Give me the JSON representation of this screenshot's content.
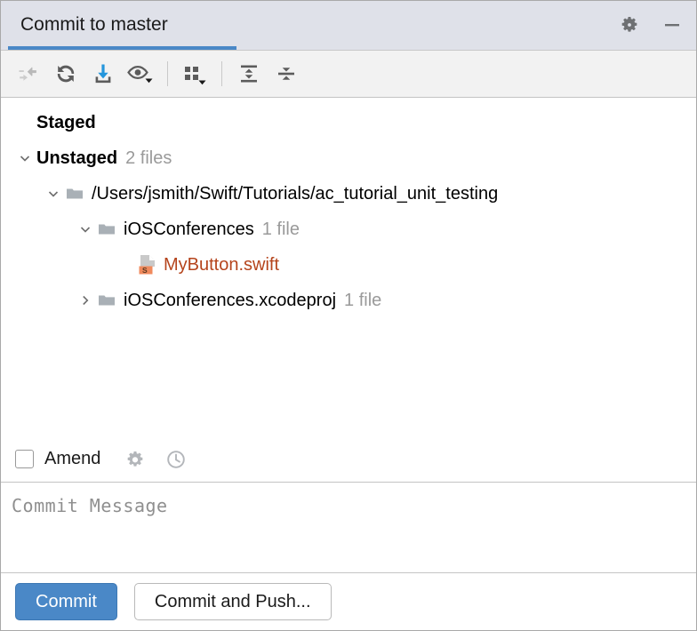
{
  "window": {
    "tab_title": "Commit to master",
    "accent_color": "#4a88c7",
    "header_bg": "#dfe1e9",
    "settings_icon": "gear-icon",
    "minimize_icon": "minimize-icon"
  },
  "toolbar": {
    "items": [
      {
        "name": "collapse-changes-icon",
        "tooltip": "Collapse",
        "enabled": false
      },
      {
        "name": "refresh-icon",
        "tooltip": "Refresh",
        "enabled": true
      },
      {
        "name": "revert-download-icon",
        "tooltip": "Revert",
        "enabled": true
      },
      {
        "name": "preview-diff-icon",
        "tooltip": "Preview Diff",
        "enabled": true
      },
      {
        "name": "group-by-icon",
        "tooltip": "Group By",
        "enabled": true
      },
      {
        "name": "expand-all-icon",
        "tooltip": "Expand All",
        "enabled": true
      },
      {
        "name": "collapse-all-icon",
        "tooltip": "Collapse All",
        "enabled": true
      }
    ]
  },
  "tree": {
    "nodes": [
      {
        "id": "staged",
        "label": "Staged",
        "count": "",
        "indent": 0,
        "twisty": "none",
        "kind": "group"
      },
      {
        "id": "unstaged",
        "label": "Unstaged",
        "count": "2 files",
        "indent": 0,
        "twisty": "expanded",
        "kind": "group"
      },
      {
        "id": "root-path",
        "label": "/Users/jsmith/Swift/Tutorials/ac_tutorial_unit_testing",
        "count": "",
        "indent": 1,
        "twisty": "expanded",
        "kind": "folder"
      },
      {
        "id": "iosconferences",
        "label": "iOSConferences",
        "count": "1 file",
        "indent": 2,
        "twisty": "expanded",
        "kind": "folder"
      },
      {
        "id": "mybutton",
        "label": "MyButton.swift",
        "count": "",
        "indent": 3,
        "twisty": "none",
        "kind": "file",
        "file_color": "#b5441c",
        "file_icon": "swift-file-icon"
      },
      {
        "id": "xcodeproj",
        "label": "iOSConferences.xcodeproj",
        "count": "1 file",
        "indent": 2,
        "twisty": "collapsed",
        "kind": "folder"
      }
    ]
  },
  "amend": {
    "label": "Amend",
    "checked": false,
    "settings_icon": "gear-icon",
    "history_icon": "clock-icon"
  },
  "commit_message": {
    "value": "",
    "placeholder": "Commit Message"
  },
  "buttons": {
    "commit": "Commit",
    "commit_and_push": "Commit and Push..."
  }
}
